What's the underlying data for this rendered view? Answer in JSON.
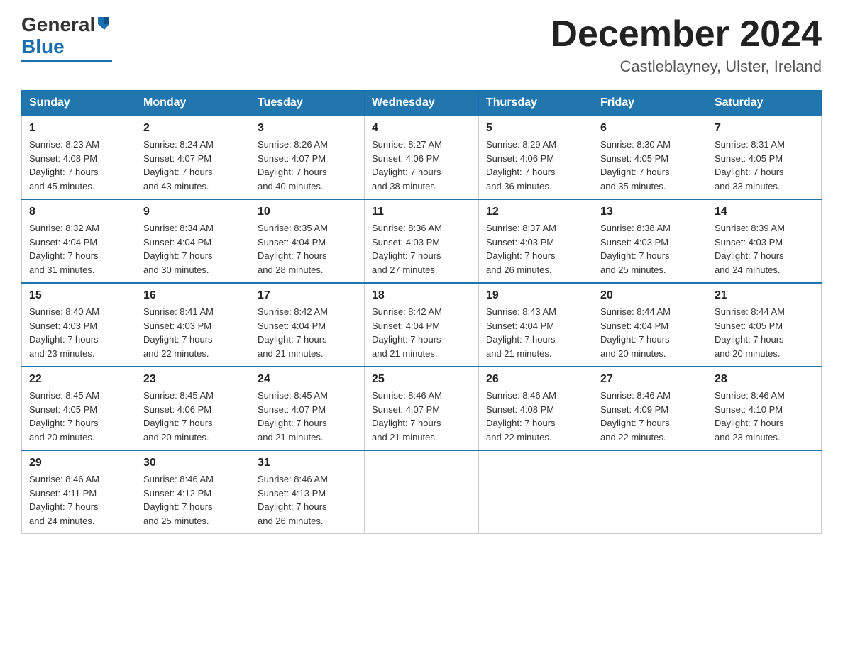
{
  "header": {
    "logo_text_black": "General",
    "logo_text_blue": "Blue",
    "month_title": "December 2024",
    "location": "Castleblayney, Ulster, Ireland"
  },
  "calendar": {
    "days_of_week": [
      "Sunday",
      "Monday",
      "Tuesday",
      "Wednesday",
      "Thursday",
      "Friday",
      "Saturday"
    ],
    "weeks": [
      [
        {
          "day": "1",
          "info": "Sunrise: 8:23 AM\nSunset: 4:08 PM\nDaylight: 7 hours\nand 45 minutes."
        },
        {
          "day": "2",
          "info": "Sunrise: 8:24 AM\nSunset: 4:07 PM\nDaylight: 7 hours\nand 43 minutes."
        },
        {
          "day": "3",
          "info": "Sunrise: 8:26 AM\nSunset: 4:07 PM\nDaylight: 7 hours\nand 40 minutes."
        },
        {
          "day": "4",
          "info": "Sunrise: 8:27 AM\nSunset: 4:06 PM\nDaylight: 7 hours\nand 38 minutes."
        },
        {
          "day": "5",
          "info": "Sunrise: 8:29 AM\nSunset: 4:06 PM\nDaylight: 7 hours\nand 36 minutes."
        },
        {
          "day": "6",
          "info": "Sunrise: 8:30 AM\nSunset: 4:05 PM\nDaylight: 7 hours\nand 35 minutes."
        },
        {
          "day": "7",
          "info": "Sunrise: 8:31 AM\nSunset: 4:05 PM\nDaylight: 7 hours\nand 33 minutes."
        }
      ],
      [
        {
          "day": "8",
          "info": "Sunrise: 8:32 AM\nSunset: 4:04 PM\nDaylight: 7 hours\nand 31 minutes."
        },
        {
          "day": "9",
          "info": "Sunrise: 8:34 AM\nSunset: 4:04 PM\nDaylight: 7 hours\nand 30 minutes."
        },
        {
          "day": "10",
          "info": "Sunrise: 8:35 AM\nSunset: 4:04 PM\nDaylight: 7 hours\nand 28 minutes."
        },
        {
          "day": "11",
          "info": "Sunrise: 8:36 AM\nSunset: 4:03 PM\nDaylight: 7 hours\nand 27 minutes."
        },
        {
          "day": "12",
          "info": "Sunrise: 8:37 AM\nSunset: 4:03 PM\nDaylight: 7 hours\nand 26 minutes."
        },
        {
          "day": "13",
          "info": "Sunrise: 8:38 AM\nSunset: 4:03 PM\nDaylight: 7 hours\nand 25 minutes."
        },
        {
          "day": "14",
          "info": "Sunrise: 8:39 AM\nSunset: 4:03 PM\nDaylight: 7 hours\nand 24 minutes."
        }
      ],
      [
        {
          "day": "15",
          "info": "Sunrise: 8:40 AM\nSunset: 4:03 PM\nDaylight: 7 hours\nand 23 minutes."
        },
        {
          "day": "16",
          "info": "Sunrise: 8:41 AM\nSunset: 4:03 PM\nDaylight: 7 hours\nand 22 minutes."
        },
        {
          "day": "17",
          "info": "Sunrise: 8:42 AM\nSunset: 4:04 PM\nDaylight: 7 hours\nand 21 minutes."
        },
        {
          "day": "18",
          "info": "Sunrise: 8:42 AM\nSunset: 4:04 PM\nDaylight: 7 hours\nand 21 minutes."
        },
        {
          "day": "19",
          "info": "Sunrise: 8:43 AM\nSunset: 4:04 PM\nDaylight: 7 hours\nand 21 minutes."
        },
        {
          "day": "20",
          "info": "Sunrise: 8:44 AM\nSunset: 4:04 PM\nDaylight: 7 hours\nand 20 minutes."
        },
        {
          "day": "21",
          "info": "Sunrise: 8:44 AM\nSunset: 4:05 PM\nDaylight: 7 hours\nand 20 minutes."
        }
      ],
      [
        {
          "day": "22",
          "info": "Sunrise: 8:45 AM\nSunset: 4:05 PM\nDaylight: 7 hours\nand 20 minutes."
        },
        {
          "day": "23",
          "info": "Sunrise: 8:45 AM\nSunset: 4:06 PM\nDaylight: 7 hours\nand 20 minutes."
        },
        {
          "day": "24",
          "info": "Sunrise: 8:45 AM\nSunset: 4:07 PM\nDaylight: 7 hours\nand 21 minutes."
        },
        {
          "day": "25",
          "info": "Sunrise: 8:46 AM\nSunset: 4:07 PM\nDaylight: 7 hours\nand 21 minutes."
        },
        {
          "day": "26",
          "info": "Sunrise: 8:46 AM\nSunset: 4:08 PM\nDaylight: 7 hours\nand 22 minutes."
        },
        {
          "day": "27",
          "info": "Sunrise: 8:46 AM\nSunset: 4:09 PM\nDaylight: 7 hours\nand 22 minutes."
        },
        {
          "day": "28",
          "info": "Sunrise: 8:46 AM\nSunset: 4:10 PM\nDaylight: 7 hours\nand 23 minutes."
        }
      ],
      [
        {
          "day": "29",
          "info": "Sunrise: 8:46 AM\nSunset: 4:11 PM\nDaylight: 7 hours\nand 24 minutes."
        },
        {
          "day": "30",
          "info": "Sunrise: 8:46 AM\nSunset: 4:12 PM\nDaylight: 7 hours\nand 25 minutes."
        },
        {
          "day": "31",
          "info": "Sunrise: 8:46 AM\nSunset: 4:13 PM\nDaylight: 7 hours\nand 26 minutes."
        },
        null,
        null,
        null,
        null
      ]
    ]
  }
}
